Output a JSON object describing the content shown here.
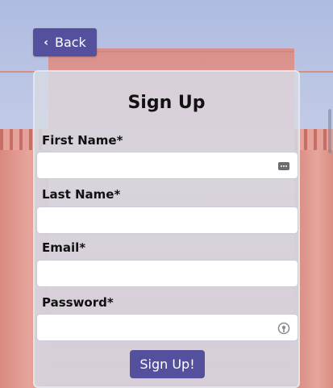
{
  "nav": {
    "back_label": "Back"
  },
  "form": {
    "title": "Sign Up",
    "fields": [
      {
        "label": "First Name*",
        "value": "",
        "icon": "autofill-card-icon"
      },
      {
        "label": "Last Name*",
        "value": ""
      },
      {
        "label": "Email*",
        "value": ""
      },
      {
        "label": "Password*",
        "value": "",
        "icon": "password-manager-icon"
      }
    ],
    "submit_label": "Sign Up!"
  },
  "colors": {
    "accent": "#55509e"
  }
}
